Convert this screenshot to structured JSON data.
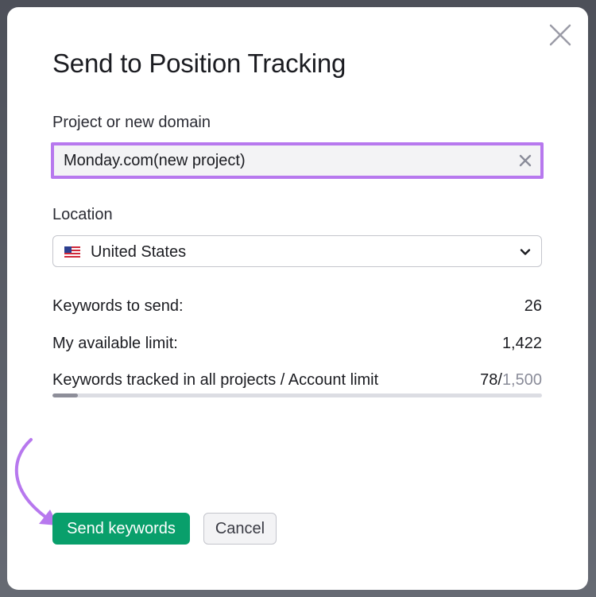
{
  "modal": {
    "title": "Send to Position Tracking",
    "close_icon": "close-icon"
  },
  "project": {
    "label": "Project or new domain",
    "value": "Monday.com(new project)",
    "clear_icon": "clear-icon",
    "highlight_color": "#b778ee"
  },
  "location": {
    "label": "Location",
    "value": "United States",
    "flag_icon": "us-flag-icon",
    "dropdown_icon": "chevron-down-icon"
  },
  "stats": {
    "keywords_to_send_label": "Keywords to send:",
    "keywords_to_send_value": "26",
    "available_limit_label": "My available limit:",
    "available_limit_value": "1,422",
    "tracked_label": "Keywords tracked in all projects / Account limit",
    "tracked_value": "78",
    "tracked_separator": "/",
    "account_limit": "1,500",
    "tracked_fraction": 0.052
  },
  "actions": {
    "send_label": "Send keywords",
    "cancel_label": "Cancel",
    "send_color": "#099f6b",
    "annotation_arrow_color": "#b778ee"
  }
}
